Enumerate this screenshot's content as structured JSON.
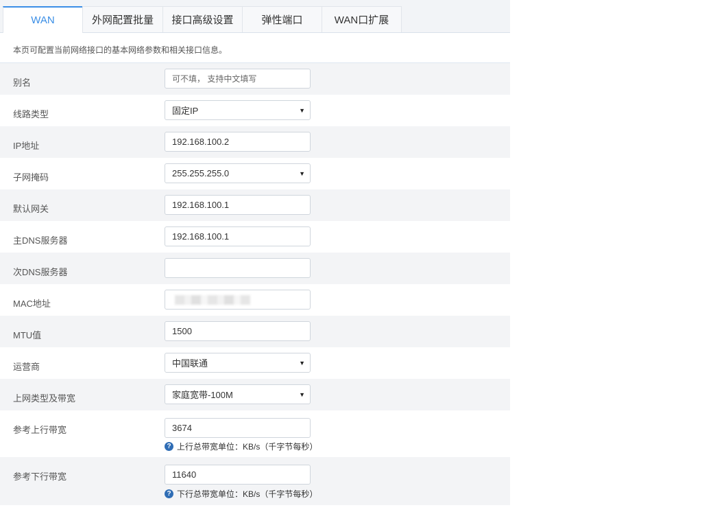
{
  "tabs": [
    {
      "label": "WAN",
      "active": true
    },
    {
      "label": "外网配置批量",
      "active": false
    },
    {
      "label": "接口高级设置",
      "active": false
    },
    {
      "label": "弹性端口",
      "active": false
    },
    {
      "label": "WAN口扩展",
      "active": false
    }
  ],
  "description": "本页可配置当前网络接口的基本网络参数和相关接口信息。",
  "form": {
    "alias": {
      "label": "别名",
      "value": "",
      "placeholder": "可不填， 支持中文填写"
    },
    "line_type": {
      "label": "线路类型",
      "value": "固定IP"
    },
    "ip": {
      "label": "IP地址",
      "value": "192.168.100.2"
    },
    "netmask": {
      "label": "子网掩码",
      "value": "255.255.255.0"
    },
    "gateway": {
      "label": "默认网关",
      "value": "192.168.100.1"
    },
    "dns1": {
      "label": "主DNS服务器",
      "value": "192.168.100.1"
    },
    "dns2": {
      "label": "次DNS服务器",
      "value": ""
    },
    "mac": {
      "label": "MAC地址",
      "value": ""
    },
    "mtu": {
      "label": "MTU值",
      "value": "1500"
    },
    "isp": {
      "label": "运营商",
      "value": "中国联通"
    },
    "bandwidth_type": {
      "label": "上网类型及带宽",
      "value": "家庭宽带-100M"
    },
    "up_bw": {
      "label": "参考上行带宽",
      "value": "3674",
      "hint": "上行总带宽单位：KB/s（千字节每秒）"
    },
    "down_bw": {
      "label": "参考下行带宽",
      "value": "11640",
      "hint": "下行总带宽单位：KB/s（千字节每秒）"
    }
  },
  "icons": {
    "select_caret": "caret-down-icon",
    "help": "question-circle-icon"
  },
  "colors": {
    "accent": "#3a8ee6",
    "help_icon": "#2f6db5",
    "row_alt": "#f3f4f6"
  }
}
